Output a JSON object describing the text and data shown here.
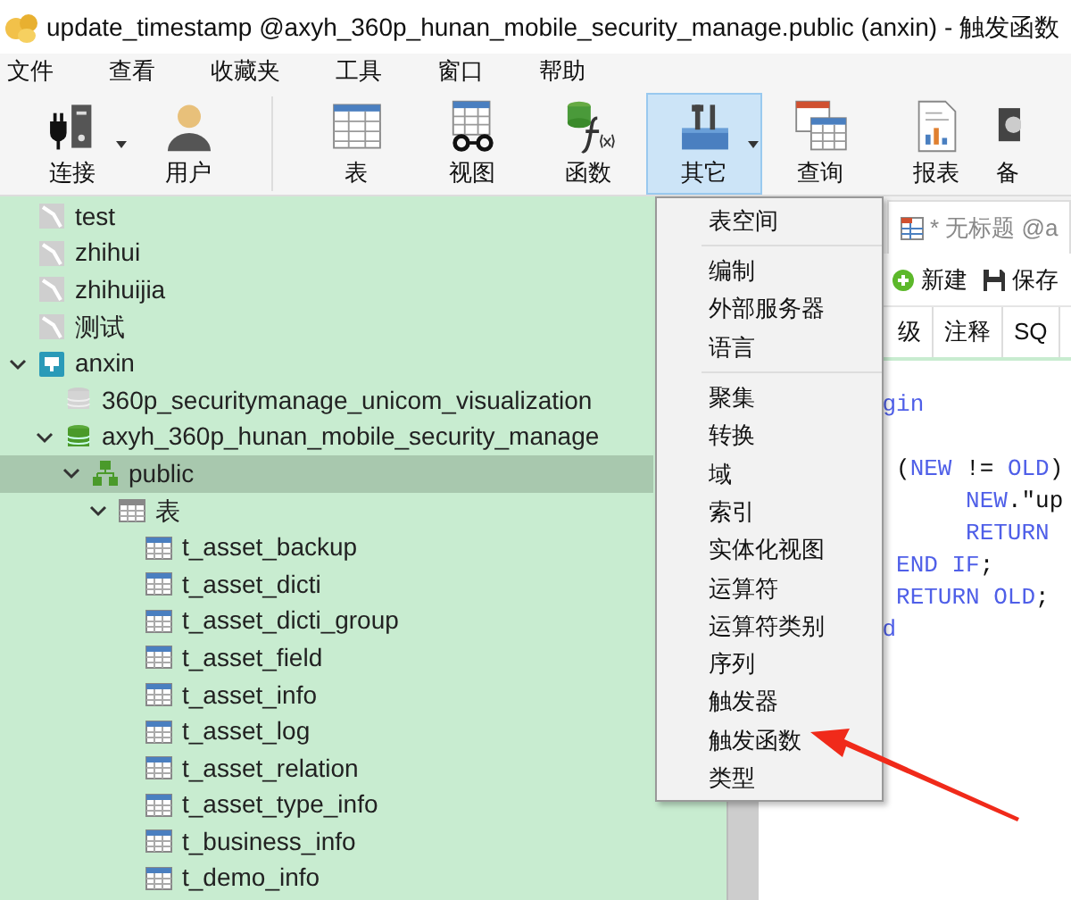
{
  "window": {
    "title": "update_timestamp @axyh_360p_hunan_mobile_security_manage.public (anxin) - 触发函数"
  },
  "menu_bar": [
    "文件",
    "查看",
    "收藏夹",
    "工具",
    "窗口",
    "帮助"
  ],
  "toolbar": [
    {
      "label": "连接",
      "kind": "connection",
      "selected": false,
      "dropdown": true
    },
    {
      "label": "用户",
      "kind": "user",
      "selected": false,
      "dropdown": false
    },
    {
      "label": "表",
      "kind": "table",
      "selected": false,
      "dropdown": false
    },
    {
      "label": "视图",
      "kind": "view",
      "selected": false,
      "dropdown": false
    },
    {
      "label": "函数",
      "kind": "function",
      "selected": false,
      "dropdown": false
    },
    {
      "label": "其它",
      "kind": "other",
      "selected": true,
      "dropdown": true
    },
    {
      "label": "查询",
      "kind": "query",
      "selected": false,
      "dropdown": false
    },
    {
      "label": "报表",
      "kind": "report",
      "selected": false,
      "dropdown": false
    },
    {
      "label": "备",
      "kind": "backup",
      "selected": false,
      "dropdown": false
    }
  ],
  "tree": [
    {
      "label": "test",
      "kind": "connection",
      "selected": false
    },
    {
      "label": "zhihui",
      "kind": "connection",
      "selected": false
    },
    {
      "label": "zhihuijia",
      "kind": "connection",
      "selected": false
    },
    {
      "label": "测试",
      "kind": "connection",
      "selected": false
    },
    {
      "label": "anxin",
      "kind": "server",
      "selected": false,
      "expanded": true,
      "children": [
        {
          "label": "360p_securitymanage_unicom_visualization",
          "kind": "database_closed",
          "selected": false
        },
        {
          "label": "axyh_360p_hunan_mobile_security_manage",
          "kind": "database",
          "selected": false,
          "expanded": true,
          "children": [
            {
              "label": "public",
              "kind": "schema",
              "selected": true,
              "expanded": true,
              "children": [
                {
                  "label": "表",
                  "kind": "tables",
                  "selected": false,
                  "expanded": true,
                  "children": [
                    {
                      "label": "t_asset_backup",
                      "kind": "table",
                      "selected": false
                    },
                    {
                      "label": "t_asset_dicti",
                      "kind": "table",
                      "selected": false
                    },
                    {
                      "label": "t_asset_dicti_group",
                      "kind": "table",
                      "selected": false
                    },
                    {
                      "label": "t_asset_field",
                      "kind": "table",
                      "selected": false
                    },
                    {
                      "label": "t_asset_info",
                      "kind": "table",
                      "selected": false
                    },
                    {
                      "label": "t_asset_log",
                      "kind": "table",
                      "selected": false
                    },
                    {
                      "label": "t_asset_relation",
                      "kind": "table",
                      "selected": false
                    },
                    {
                      "label": "t_asset_type_info",
                      "kind": "table",
                      "selected": false
                    },
                    {
                      "label": "t_business_info",
                      "kind": "table",
                      "selected": false
                    },
                    {
                      "label": "t_demo_info",
                      "kind": "table",
                      "selected": false
                    }
                  ]
                }
              ]
            }
          ]
        }
      ]
    }
  ],
  "dropdown_menu": [
    [
      "表空间"
    ],
    [
      "编制",
      "外部服务器",
      "语言"
    ],
    [
      "聚集",
      "转换",
      "域",
      "索引",
      "实体化视图",
      "运算符",
      "运算符类别",
      "序列",
      "触发器",
      "触发函数",
      "类型"
    ]
  ],
  "editor": {
    "tab": "* 无标题 @a",
    "actions": [
      {
        "label": "新建",
        "kind": "new"
      },
      {
        "label": "保存",
        "kind": "save"
      }
    ],
    "column_tabs": [
      "级",
      "注释",
      "SQ"
    ],
    "code": [
      [
        {
          "text": "         gin",
          "kind": "keyword"
        }
      ],
      [
        {
          "text": "          (",
          "kind": "plain",
          "gap_before": true
        },
        {
          "text": "NEW",
          "kind": "keyword"
        },
        {
          "text": " != ",
          "kind": "plain"
        },
        {
          "text": "OLD",
          "kind": "keyword"
        },
        {
          "text": ")",
          "kind": "plain"
        }
      ],
      [
        {
          "text": "               NEW",
          "kind": "keyword"
        },
        {
          "text": ".\"up",
          "kind": "plain"
        }
      ],
      [
        {
          "text": "               RETURN",
          "kind": "keyword"
        }
      ],
      [
        {
          "text": "          END IF",
          "kind": "keyword"
        },
        {
          "text": ";",
          "kind": "plain"
        }
      ],
      [
        {
          "text": "          RETURN OLD",
          "kind": "keyword"
        },
        {
          "text": ";",
          "kind": "plain"
        }
      ],
      [
        {
          "text": "         d",
          "kind": "keyword"
        }
      ]
    ]
  },
  "annotation": {
    "kind": "arrow"
  }
}
